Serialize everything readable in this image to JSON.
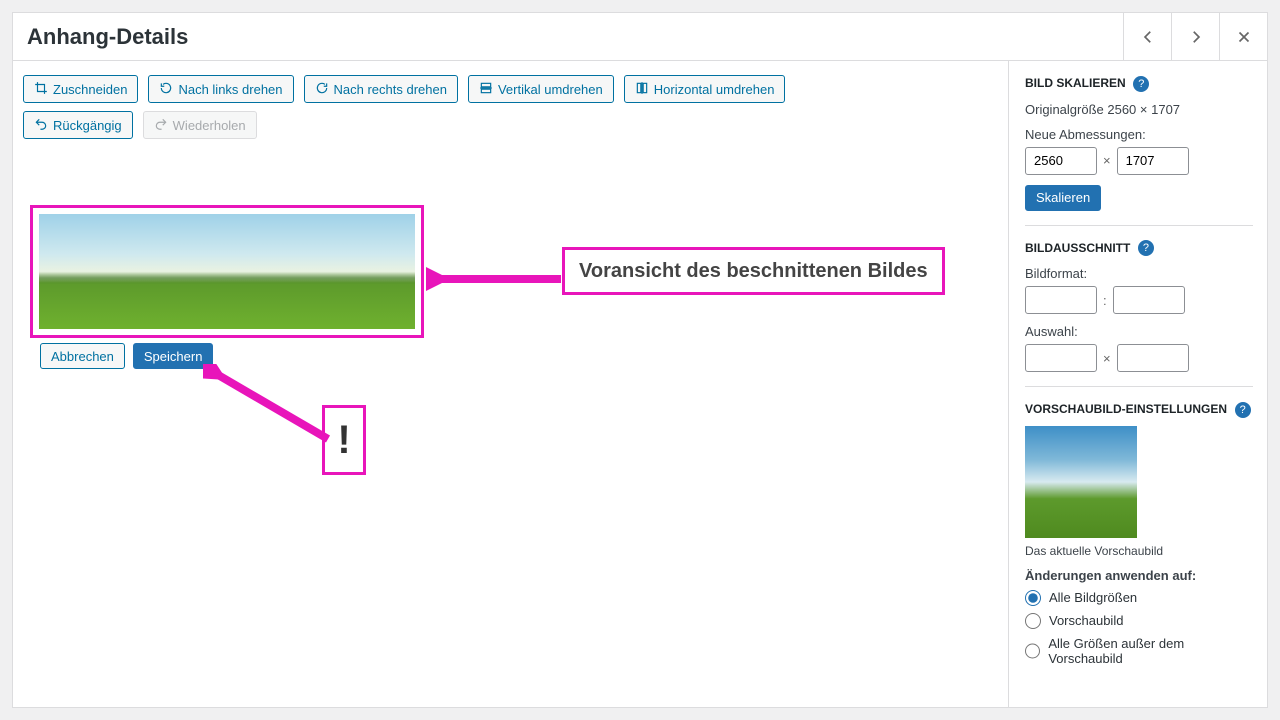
{
  "header": {
    "title": "Anhang-Details"
  },
  "toolbar": {
    "crop": "Zuschneiden",
    "rotate_left": "Nach links drehen",
    "rotate_right": "Nach rechts drehen",
    "flip_v": "Vertikal umdrehen",
    "flip_h": "Horizontal umdrehen",
    "undo": "Rückgängig",
    "redo": "Wiederholen"
  },
  "actions": {
    "cancel": "Abbrechen",
    "save": "Speichern"
  },
  "scale": {
    "heading": "BILD SKALIEREN",
    "original_label": "Originalgröße 2560 × 1707",
    "new_label": "Neue Abmessungen:",
    "width": "2560",
    "height": "1707",
    "sep": "×",
    "button": "Skalieren"
  },
  "crop": {
    "heading": "BILDAUSSCHNITT",
    "ratio_label": "Bildformat:",
    "ratio_sep": ":",
    "selection_label": "Auswahl:",
    "sel_sep": "×"
  },
  "thumb": {
    "heading": "VORSCHAUBILD-EINSTELLUNGEN",
    "caption": "Das aktuelle Vorschaubild",
    "apply_label": "Änderungen anwenden auf:",
    "opt_all": "Alle Bildgrößen",
    "opt_thumb": "Vorschaubild",
    "opt_except": "Alle Größen außer dem Vorschaubild"
  },
  "annotations": {
    "preview_label": "Voransicht des beschnittenen Bildes",
    "exclaim": "!"
  }
}
